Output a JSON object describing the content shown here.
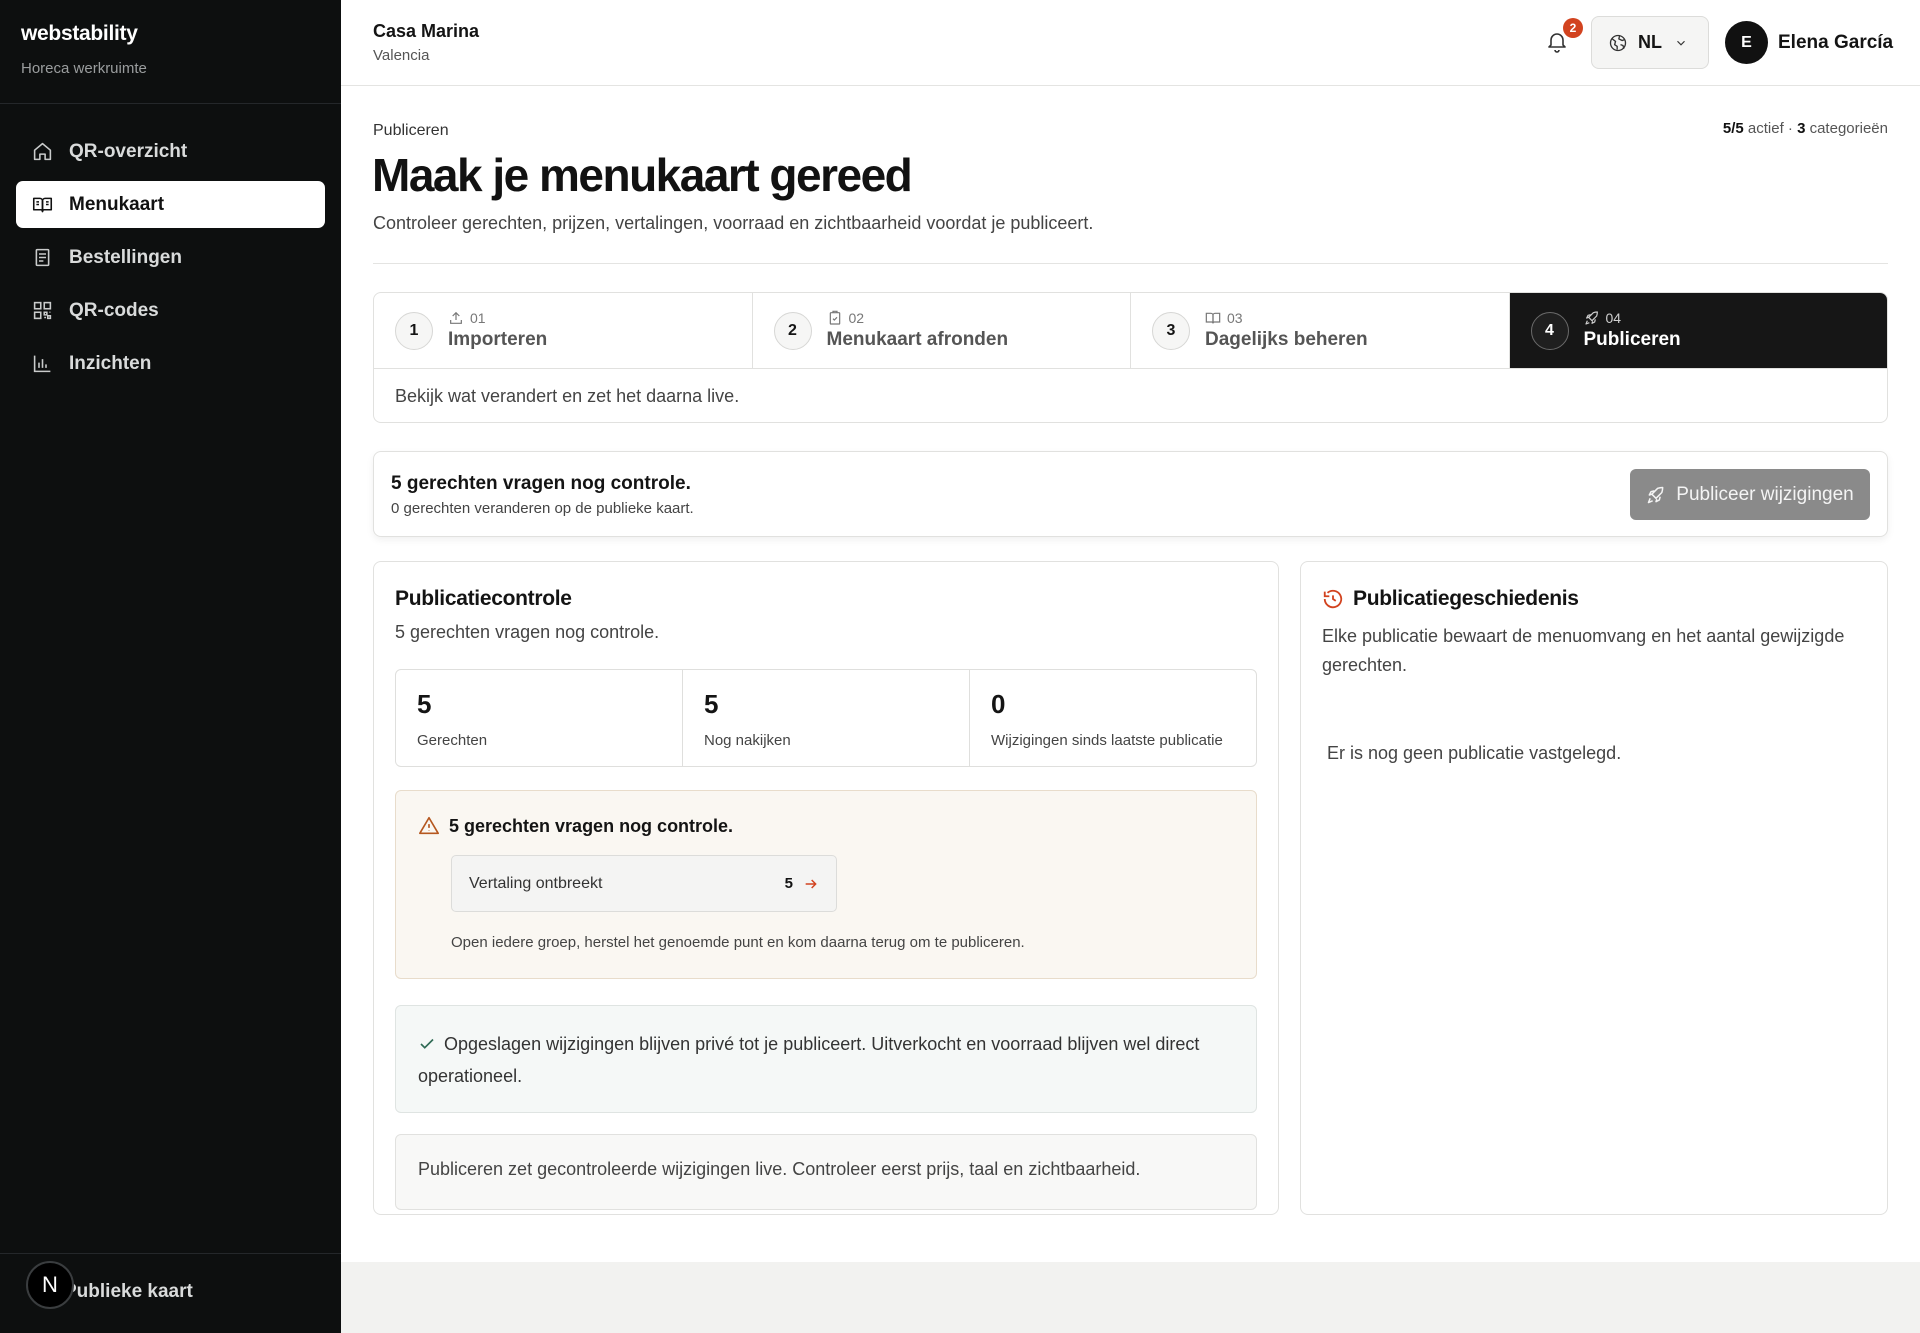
{
  "sidebar": {
    "brand": "webstability",
    "workspace": "Horeca werkruimte",
    "items": [
      {
        "label": "QR-overzicht",
        "icon": "home-icon"
      },
      {
        "label": "Menukaart",
        "icon": "book-icon"
      },
      {
        "label": "Bestellingen",
        "icon": "receipt-icon"
      },
      {
        "label": "QR-codes",
        "icon": "qr-icon"
      },
      {
        "label": "Inzichten",
        "icon": "bar-chart-icon"
      }
    ],
    "public_link": "Publieke kaart",
    "n_badge": "N"
  },
  "topbar": {
    "venue": "Casa Marina",
    "city": "Valencia",
    "notifications": "2",
    "language": "NL",
    "avatar_initial": "E",
    "user": "Elena García"
  },
  "page": {
    "eyebrow": "Publiceren",
    "summary_active": "5/5",
    "summary_active_label": "actief ·",
    "summary_categories": "3",
    "summary_categories_label": "categorieën",
    "title": "Maak je menukaart gereed",
    "description": "Controleer gerechten, prijzen, vertalingen, voorraad en zichtbaarheid voordat je publiceert."
  },
  "steps": [
    {
      "num": "1",
      "code": "01",
      "label": "Importeren",
      "icon": "upload-icon"
    },
    {
      "num": "2",
      "code": "02",
      "label": "Menukaart afronden",
      "icon": "clipboard-icon"
    },
    {
      "num": "3",
      "code": "03",
      "label": "Dagelijks beheren",
      "icon": "book-icon"
    },
    {
      "num": "4",
      "code": "04",
      "label": "Publiceren",
      "icon": "rocket-icon"
    }
  ],
  "step_hint": "Bekijk wat verandert en zet het daarna live.",
  "publish_bar": {
    "title": "5 gerechten vragen nog controle.",
    "subtitle": "0 gerechten veranderen op de publieke kaart.",
    "button": "Publiceer wijzigingen"
  },
  "check": {
    "title": "Publicatiecontrole",
    "subtitle": "5 gerechten vragen nog controle.",
    "stats": [
      {
        "value": "5",
        "label": "Gerechten"
      },
      {
        "value": "5",
        "label": "Nog nakijken"
      },
      {
        "value": "0",
        "label": "Wijzigingen sinds laatste publicatie"
      }
    ],
    "warning_title": "5 gerechten vragen nog controle.",
    "issue_label": "Vertaling ontbreekt",
    "issue_count": "5",
    "warning_note": "Open iedere groep, herstel het genoemde punt en kom daarna terug om te publiceren.",
    "ok_text": "Opgeslagen wijzigingen blijven privé tot je publiceert. Uitverkocht en voorraad blijven wel direct operationeel.",
    "info_text": "Publiceren zet gecontroleerde wijzigingen live. Controleer eerst prijs, taal en zichtbaarheid."
  },
  "history": {
    "title": "Publicatiegeschiedenis",
    "subtitle": "Elke publicatie bewaart de menuomvang en het aantal gewijzigde gerechten.",
    "empty": "Er is nog geen publicatie vastgelegd."
  },
  "colors": {
    "sidebar_bg": "#0d0f0f",
    "accent_orange": "#d2431f",
    "active_step_bg": "#161616",
    "publish_btn_disabled": "#8a8a8a"
  }
}
